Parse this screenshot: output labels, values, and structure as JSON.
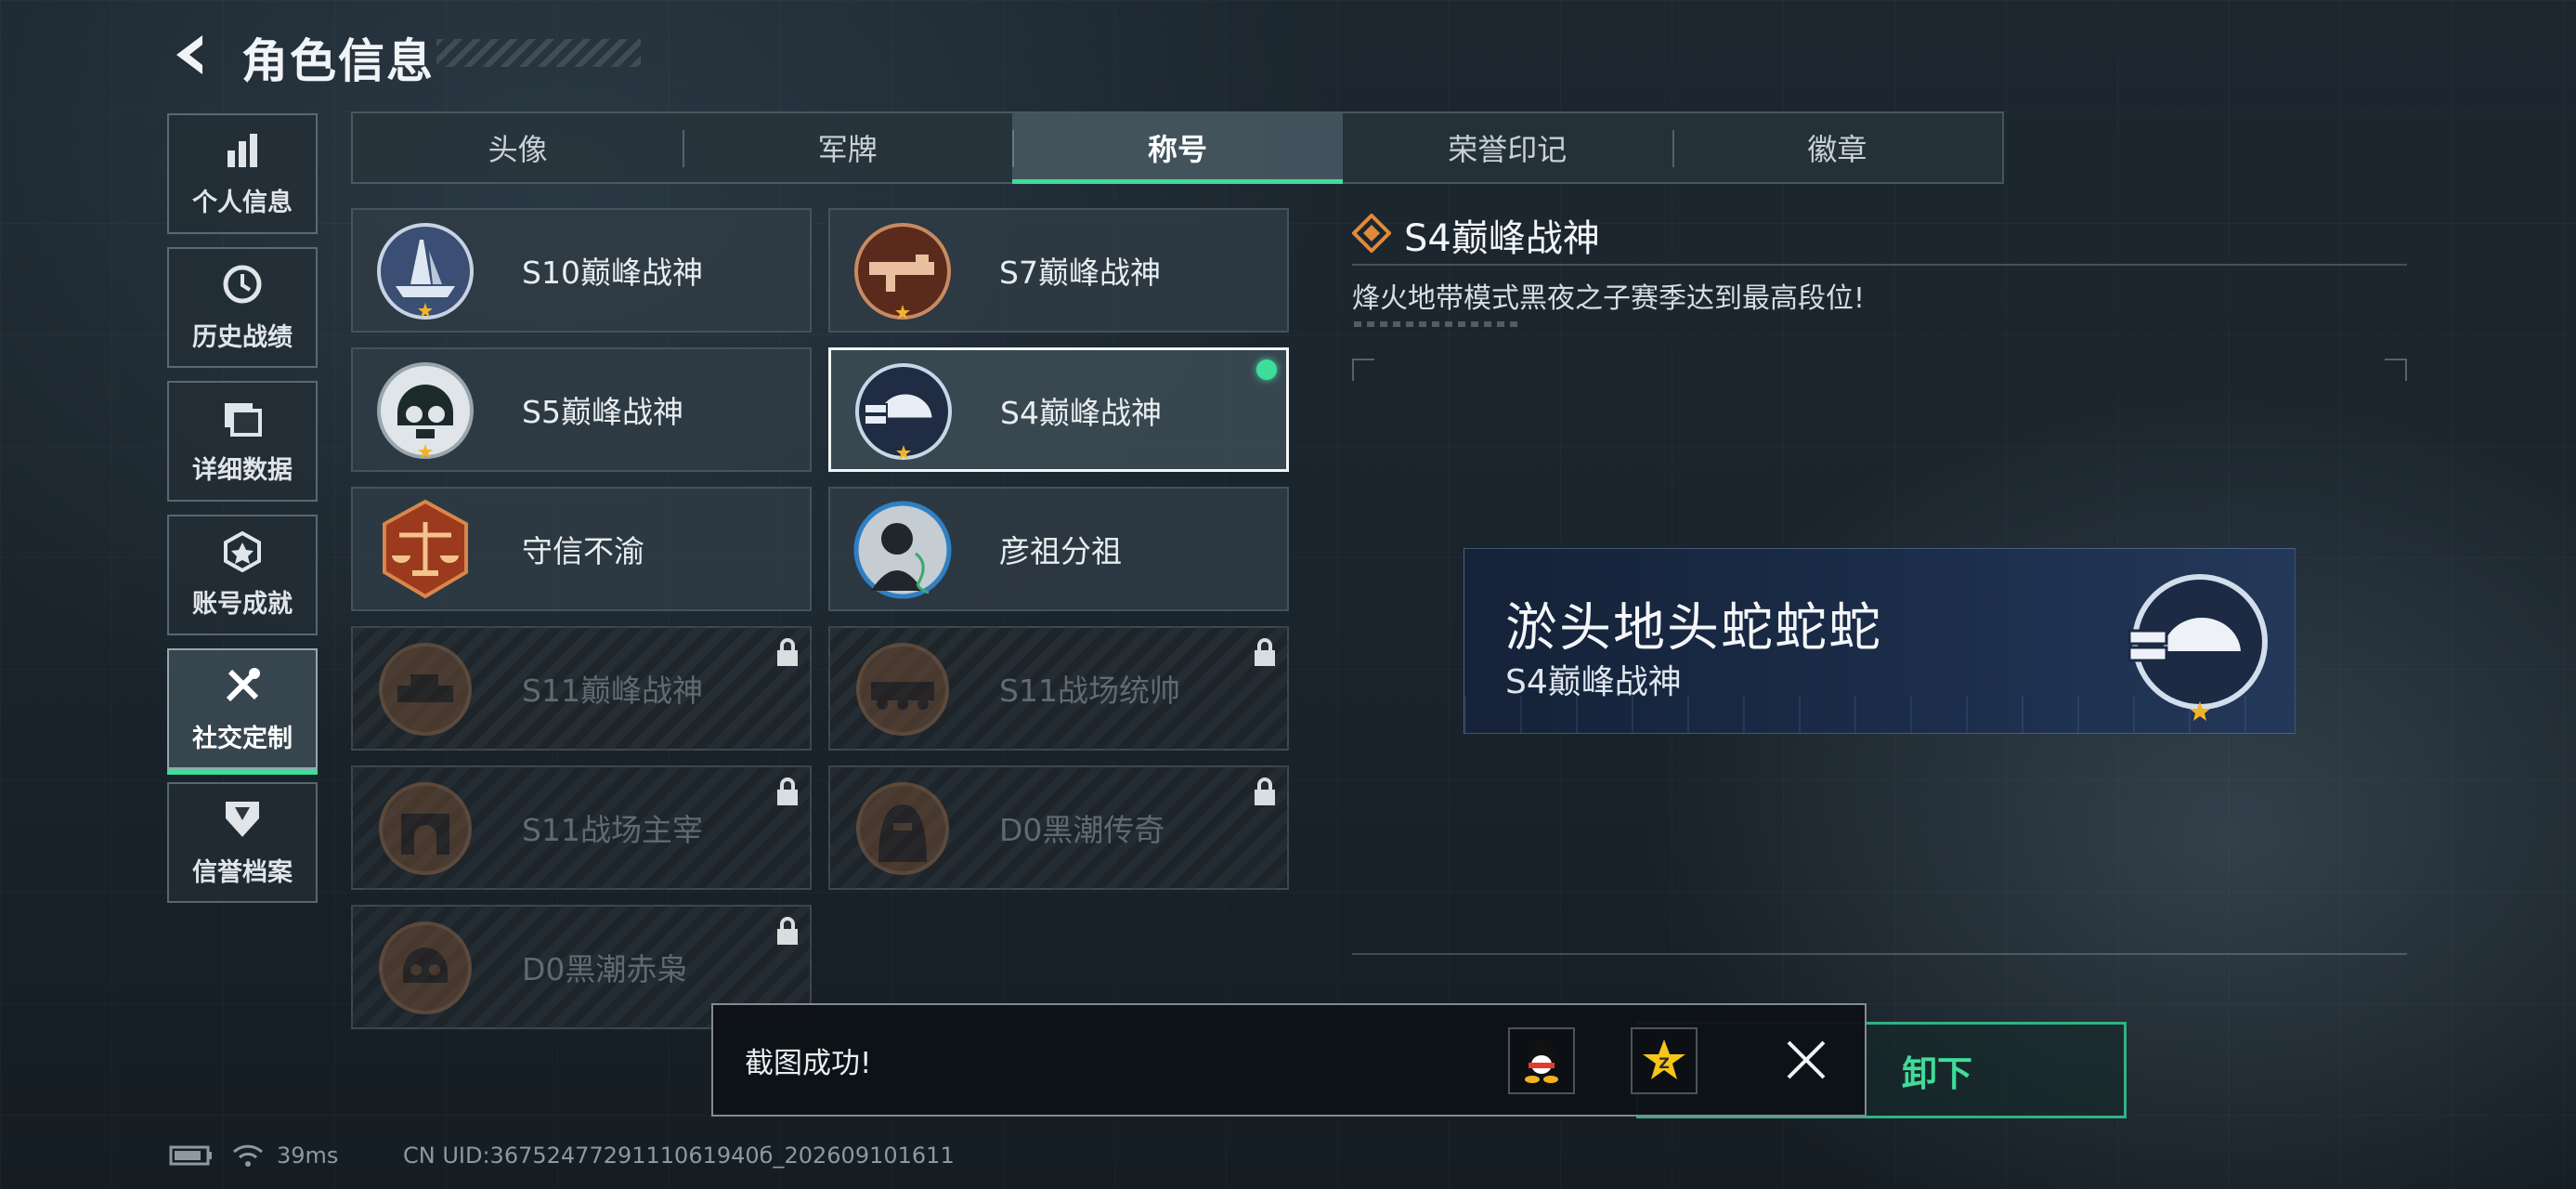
{
  "header": {
    "title": "角色信息"
  },
  "nav": {
    "items": [
      {
        "label": "个人信息",
        "icon": "bar-chart-icon"
      },
      {
        "label": "历史战绩",
        "icon": "clock-icon"
      },
      {
        "label": "详细数据",
        "icon": "folder-icon"
      },
      {
        "label": "账号成就",
        "icon": "achievement-icon"
      },
      {
        "label": "社交定制",
        "icon": "tools-icon",
        "active": true
      },
      {
        "label": "信誉档案",
        "icon": "shield-icon"
      }
    ]
  },
  "tabs": [
    {
      "label": "头像"
    },
    {
      "label": "军牌"
    },
    {
      "label": "称号",
      "active": true
    },
    {
      "label": "荣誉印记"
    },
    {
      "label": "徽章"
    }
  ],
  "titles": [
    {
      "name": "S10巅峰战神",
      "locked": false,
      "emblem": "ship-emblem-icon"
    },
    {
      "name": "S7巅峰战神",
      "locked": false,
      "emblem": "rifle-emblem-icon"
    },
    {
      "name": "S5巅峰战神",
      "locked": false,
      "emblem": "diver-skull-emblem-icon"
    },
    {
      "name": "S4巅峰战神",
      "locked": false,
      "selected": true,
      "equipped": true,
      "emblem": "nightvision-helmet-emblem-icon"
    },
    {
      "name": "守信不渝",
      "locked": false,
      "emblem": "scales-emblem-icon"
    },
    {
      "name": "彦祖分祖",
      "locked": false,
      "emblem": "portrait-emblem-icon"
    },
    {
      "name": "S11巅峰战神",
      "locked": true,
      "emblem": "tank-emblem-icon"
    },
    {
      "name": "S11战场统帅",
      "locked": true,
      "emblem": "apc-emblem-icon"
    },
    {
      "name": "S11战场主宰",
      "locked": true,
      "emblem": "arch-emblem-icon"
    },
    {
      "name": "D0黑潮传奇",
      "locked": true,
      "emblem": "hooded-emblem-icon"
    },
    {
      "name": "D0黑潮赤枭",
      "locked": true,
      "emblem": "skull-emblem-icon"
    }
  ],
  "detail": {
    "title": "S4巅峰战神",
    "description": "烽火地带模式黑夜之子赛季达到最高段位!"
  },
  "banner": {
    "player_name": "淤头地头蛇蛇蛇",
    "title": "S4巅峰战神"
  },
  "unequip_button": {
    "label": "卸下"
  },
  "toast": {
    "message": "截图成功!",
    "share_targets": [
      "qq-icon",
      "qzone-icon"
    ]
  },
  "status": {
    "ping": "39ms",
    "uid": "CN UID:3675247729111061940б_202609101611"
  },
  "colors": {
    "accent": "#3fdc9a",
    "bronze": "#8a5a38",
    "gold_star": "#f0b429"
  }
}
